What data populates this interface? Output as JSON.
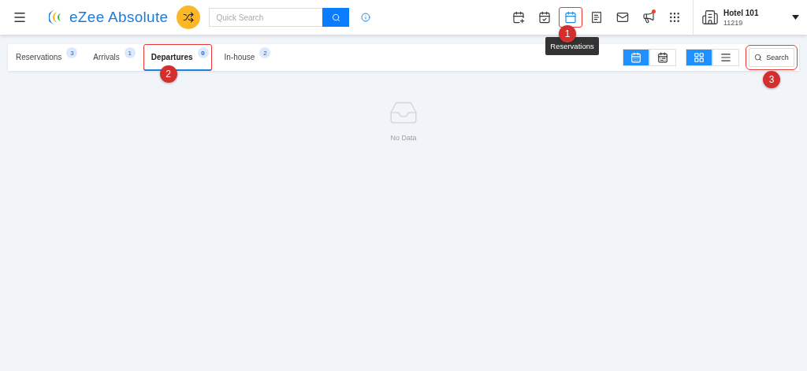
{
  "header": {
    "app_name": "eZee Absolute",
    "quick_search": {
      "placeholder": "Quick Search"
    },
    "toolbar": [
      {
        "kind": "calendar-add",
        "selected": false,
        "alert": false
      },
      {
        "kind": "calendar-check",
        "selected": false,
        "alert": false
      },
      {
        "kind": "calendar",
        "selected": true,
        "alert": false,
        "callout": "1"
      },
      {
        "kind": "billing",
        "selected": false,
        "alert": false
      },
      {
        "kind": "mail",
        "selected": false,
        "alert": false
      },
      {
        "kind": "megaphone",
        "selected": false,
        "alert": true
      },
      {
        "kind": "apps",
        "selected": false,
        "alert": false
      }
    ],
    "tooltip": "Reservations",
    "hotel": {
      "name": "Hotel 101",
      "code": "11219"
    }
  },
  "tabs": [
    {
      "label": "Reservations",
      "count": "3",
      "selected": false
    },
    {
      "label": "Arrivals",
      "count": "1",
      "selected": false
    },
    {
      "label": "Departures",
      "count": "0",
      "selected": true,
      "callout": "2"
    },
    {
      "label": "In-house",
      "count": "2",
      "selected": false
    }
  ],
  "view_toggles": [
    {
      "kind": "room-view",
      "selected": true
    },
    {
      "kind": "guest-view",
      "selected": false
    }
  ],
  "layout_toggles": [
    {
      "kind": "grid",
      "selected": true
    },
    {
      "kind": "list",
      "selected": false
    }
  ],
  "search_button": {
    "label": "Search",
    "callout": "3"
  },
  "empty_state": "No Data"
}
